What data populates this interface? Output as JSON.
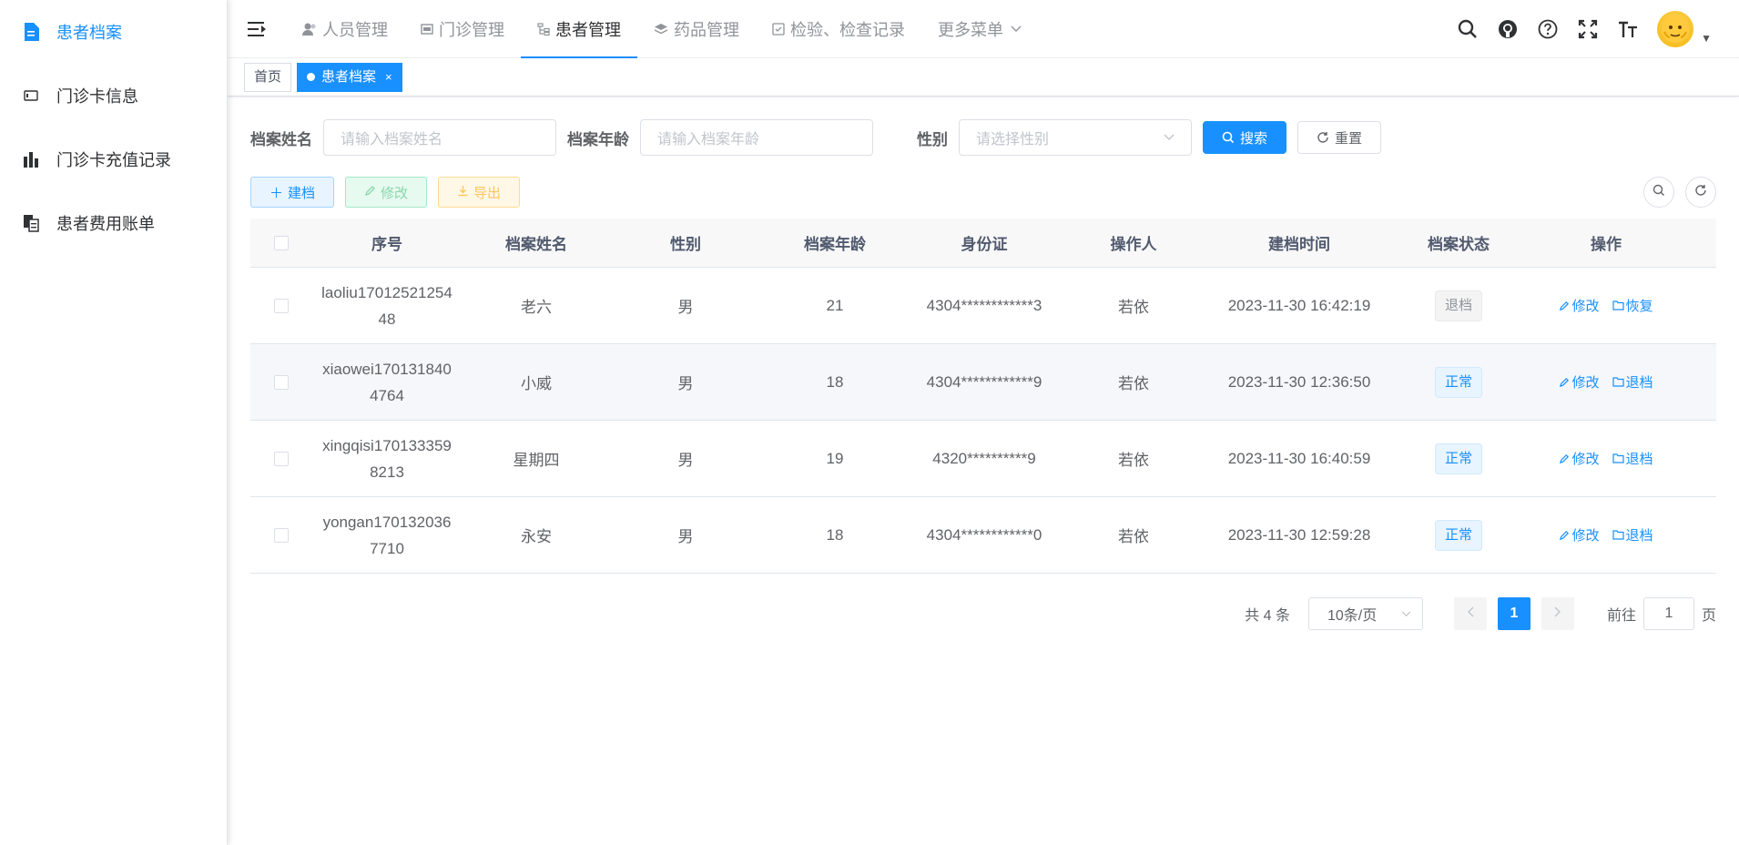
{
  "sidebar": {
    "items": [
      {
        "label": "患者档案",
        "icon": "document-icon",
        "active": true
      },
      {
        "label": "门诊卡信息",
        "icon": "card-icon"
      },
      {
        "label": "门诊卡充值记录",
        "icon": "bar-chart-icon"
      },
      {
        "label": "患者费用账单",
        "icon": "bill-icon"
      }
    ]
  },
  "navbar": {
    "menus": [
      {
        "label": "人员管理",
        "icon": "people-icon"
      },
      {
        "label": "门诊管理",
        "icon": "clinic-icon"
      },
      {
        "label": "患者管理",
        "icon": "tree-icon",
        "active": true
      },
      {
        "label": "药品管理",
        "icon": "layers-icon"
      },
      {
        "label": "检验、检查记录",
        "icon": "checkbox-icon"
      },
      {
        "label": "更多菜单",
        "icon": "chevron-down-icon"
      }
    ]
  },
  "tags": {
    "home": "首页",
    "current": "患者档案",
    "close": "×"
  },
  "search": {
    "name_label": "档案姓名",
    "name_placeholder": "请输入档案姓名",
    "age_label": "档案年龄",
    "age_placeholder": "请输入档案年龄",
    "gender_label": "性别",
    "gender_placeholder": "请选择性别",
    "search_btn": "搜索",
    "reset_btn": "重置"
  },
  "toolbar": {
    "add": "建档",
    "edit": "修改",
    "export": "导出"
  },
  "table": {
    "headers": [
      "序号",
      "档案姓名",
      "性别",
      "档案年龄",
      "身份证",
      "操作人",
      "建档时间",
      "档案状态",
      "操作"
    ],
    "rows": [
      {
        "id": "laoliu1701252125448",
        "name": "老六",
        "gender": "男",
        "age": "21",
        "idcard": "4304************3",
        "operator": "若依",
        "time": "2023-11-30 16:42:19",
        "status": "退档",
        "status_type": "info",
        "op1": "修改",
        "op2": "恢复"
      },
      {
        "id": "xiaowei1701318404764",
        "name": "小威",
        "gender": "男",
        "age": "18",
        "idcard": "4304************9",
        "operator": "若依",
        "time": "2023-11-30 12:36:50",
        "status": "正常",
        "status_type": "primary",
        "op1": "修改",
        "op2": "退档"
      },
      {
        "id": "xingqisi1701333598213",
        "name": "星期四",
        "gender": "男",
        "age": "19",
        "idcard": "4320**********9",
        "operator": "若依",
        "time": "2023-11-30 16:40:59",
        "status": "正常",
        "status_type": "primary",
        "op1": "修改",
        "op2": "退档"
      },
      {
        "id": "yongan1701320367710",
        "name": "永安",
        "gender": "男",
        "age": "18",
        "idcard": "4304************0",
        "operator": "若依",
        "time": "2023-11-30 12:59:28",
        "status": "正常",
        "status_type": "primary",
        "op1": "修改",
        "op2": "退档"
      }
    ]
  },
  "pagination": {
    "total": "共 4 条",
    "page_size": "10条/页",
    "current": "1",
    "goto_label": "前往",
    "goto_value": "1",
    "goto_suffix": "页"
  },
  "colors": {
    "primary": "#1890ff"
  }
}
